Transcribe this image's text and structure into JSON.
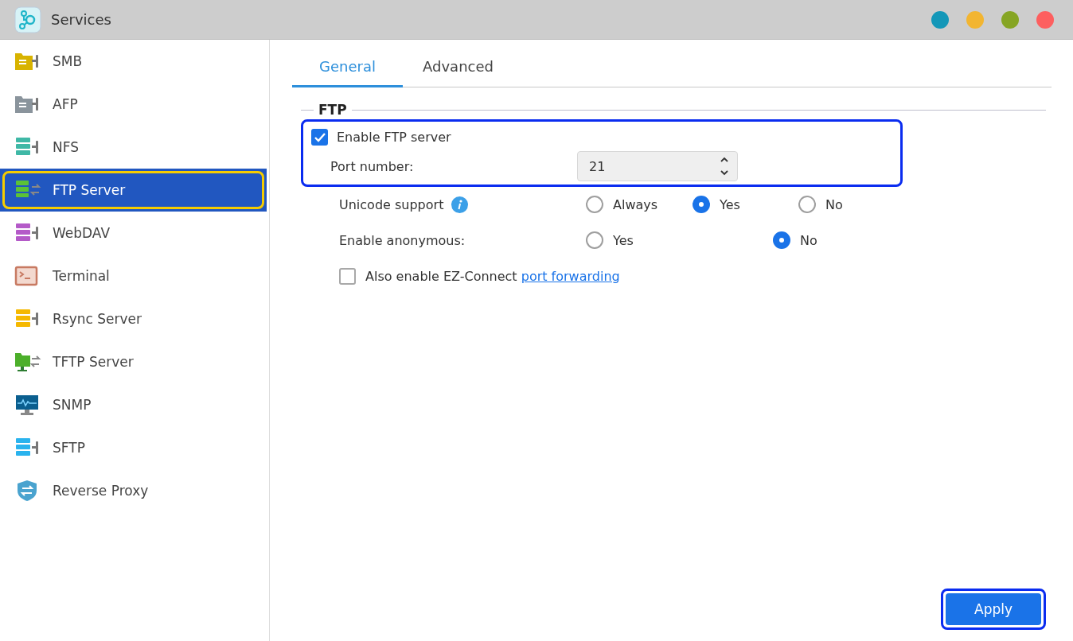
{
  "window": {
    "title": "Services",
    "controls": [
      {
        "color": "#1497b8"
      },
      {
        "color": "#f2b531"
      },
      {
        "color": "#86a524"
      },
      {
        "color": "#fd5f5f"
      }
    ]
  },
  "sidebar": {
    "items": [
      {
        "label": "SMB",
        "kind": "folder",
        "color": "#d8b300",
        "selected": false,
        "highlighted": false
      },
      {
        "label": "AFP",
        "kind": "folder",
        "color": "#8a949c",
        "selected": false,
        "highlighted": false
      },
      {
        "label": "NFS",
        "kind": "server",
        "color": "#3fb8a6",
        "selected": false,
        "highlighted": false
      },
      {
        "label": "FTP Server",
        "kind": "server-arrows",
        "color": "#5bc236",
        "selected": true,
        "highlighted": true
      },
      {
        "label": "WebDAV",
        "kind": "server",
        "color": "#b45ac8",
        "selected": false,
        "highlighted": false
      },
      {
        "label": "Terminal",
        "kind": "terminal",
        "color": "#c87a62",
        "selected": false,
        "highlighted": false
      },
      {
        "label": "Rsync Server",
        "kind": "server",
        "color": "#f5b800",
        "selected": false,
        "highlighted": false
      },
      {
        "label": "TFTP Server",
        "kind": "folder-arrows",
        "color": "#4caf2a",
        "selected": false,
        "highlighted": false
      },
      {
        "label": "SNMP",
        "kind": "monitor",
        "color": "#0b5f8f",
        "selected": false,
        "highlighted": false
      },
      {
        "label": "SFTP",
        "kind": "server",
        "color": "#2ab3ee",
        "selected": false,
        "highlighted": false
      },
      {
        "label": "Reverse Proxy",
        "kind": "shield",
        "color": "#4aa3cf",
        "selected": false,
        "highlighted": false
      }
    ]
  },
  "tabs": [
    {
      "label": "General",
      "selected": true
    },
    {
      "label": "Advanced",
      "selected": false
    }
  ],
  "section": {
    "title": "FTP",
    "enable": {
      "label": "Enable FTP server",
      "checked": true
    },
    "highlighted": true,
    "port": {
      "label": "Port number:",
      "value": "21"
    },
    "unicode": {
      "label": "Unicode support",
      "options": [
        {
          "label": "Always",
          "selected": false
        },
        {
          "label": "Yes",
          "selected": true
        },
        {
          "label": "No",
          "selected": false
        }
      ]
    },
    "anonymous": {
      "label": "Enable anonymous:",
      "options": [
        {
          "label": "Yes",
          "selected": false
        },
        {
          "label": "No",
          "selected": true
        }
      ]
    },
    "ez_connect": {
      "checked": false,
      "text": "Also enable EZ-Connect",
      "link": "port forwarding"
    }
  },
  "apply": {
    "label": "Apply",
    "highlighted": true
  }
}
